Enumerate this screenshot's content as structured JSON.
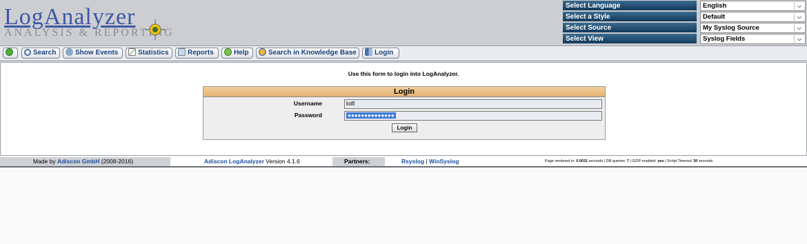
{
  "logo": {
    "title": "LogAnalyzer",
    "subtitle": "ANALYSIS & REPORTING"
  },
  "selectors": [
    {
      "label": "Select Language",
      "value": "English"
    },
    {
      "label": "Select a Style",
      "value": "Default"
    },
    {
      "label": "Select Source",
      "value": "My Syslog Source"
    },
    {
      "label": "Select View",
      "value": "Syslog Fields"
    }
  ],
  "menu": [
    {
      "label": "",
      "icon": "home-icon"
    },
    {
      "label": "Search",
      "icon": "search-icon"
    },
    {
      "label": "Show Events",
      "icon": "events-icon"
    },
    {
      "label": "Statistics",
      "icon": "chart-icon"
    },
    {
      "label": "Reports",
      "icon": "reports-icon"
    },
    {
      "label": "Help",
      "icon": "help-icon"
    },
    {
      "label": "Search in Knowledge Base",
      "icon": "knowledge-base-icon"
    },
    {
      "label": "Login",
      "icon": "login-icon"
    }
  ],
  "login": {
    "intro": "Use this form to login into LogAnalyzer.",
    "title": "Login",
    "username_label": "Username",
    "username_value": "lotfi",
    "password_label": "Password",
    "password_value": "●●●●●●●●●●●●●●",
    "button": "Login"
  },
  "footer": {
    "made_by_prefix": "Made by ",
    "made_by_link": "Adiscon GmbH",
    "made_by_years": " (2008-2016)",
    "product_link": "Adiscon LogAnalyzer",
    "version": " Version 4.1.6",
    "partners_label": "Partners:",
    "partner1": "Rsyslog",
    "separator": " | ",
    "partner2": "WinSyslog",
    "stats_prefix": "Page rendered in: ",
    "render_time": "0.0031",
    "stats_mid1": " seconds  | DB queries: ",
    "db_queries": "7",
    "stats_mid2": "  | GZIP enabled: ",
    "gzip": "yes",
    "stats_mid3": "  | Script Timeout: ",
    "timeout": "30",
    "stats_suffix": " seconds"
  },
  "colors": {
    "header_bg": "#ccced2",
    "selector_label_bg": "#1f4a6e",
    "login_title_bg": "#e8b97c",
    "link": "#1b4fa0"
  }
}
